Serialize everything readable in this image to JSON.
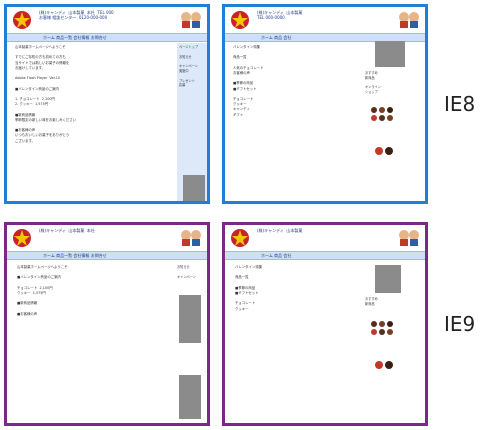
{
  "labels": {
    "ie8": "IE8",
    "ie9": "IE9"
  },
  "colors": {
    "ie8_border": "#1f7fd8",
    "ie9_border": "#7a2a86",
    "nav_bg": "#cfe0f6",
    "gray_block": "#8b8b8b"
  },
  "icons": {
    "logo": "candy-logo-icon",
    "mascot": "mascot-icon"
  },
  "shots": {
    "ie8_left": {
      "header": "(株)キャンディ  山本製菓  本社  TEL 000\nお客様 相談センター  0120-000-000",
      "nav": "ホーム  商品一覧  会社情報  お問合せ",
      "body": "山本製菓ホームページへようこそ\n\nすでにご存知の方も初めての方も\n当サイトでは新しいお菓子の情報を\nお届けしています。\n\nAdobe Flash Player  Ver.10\n\n■バレンタイン商品のご案内\n\n1. チョコレート  2,100円\n2. クッキー  1,575円\n\n■新商品情報\n季節限定の新しい味をお楽しみください\n\n■お客様の声\nいつもおいしいお菓子をありがとう\nございます。",
      "side": "ページトップ\n\nお知らせ\n\nキャンペーン\n実施中\n\nプレゼント\n応募"
    },
    "ie8_right": {
      "header": "(株)キャンディ  山本製菓\nTEL 000-0000",
      "nav": "ホーム  商品  会社",
      "body": "バレンタイン特集\n\n商品一覧\n\n人気のチョコレート\nお客様の声\n\n■季節の商品\n■ギフトセット\n\nチョコレート\nクッキー\nキャンディ\nギフト",
      "side": "おすすめ\n新商品\n\nオンライン\nショップ"
    },
    "ie9_left": {
      "header": "(株)キャンディ  山本製菓  本社",
      "nav": "ホーム  商品一覧  会社情報  お問合せ",
      "body": "山本製菓ホームページへようこそ\n\n■バレンタイン商品のご案内\n\nチョコレート  2,100円\nクッキー  1,575円\n\n■新商品情報\n\n■お客様の声",
      "side": "お知らせ\n\nキャンペーン"
    },
    "ie9_right": {
      "header": "(株)キャンディ  山本製菓",
      "nav": "ホーム  商品  会社",
      "body": "バレンタイン特集\n\n商品一覧\n\n■季節の商品\n■ギフトセット\n\nチョコレート\nクッキー",
      "side": "おすすめ\n新商品"
    }
  }
}
